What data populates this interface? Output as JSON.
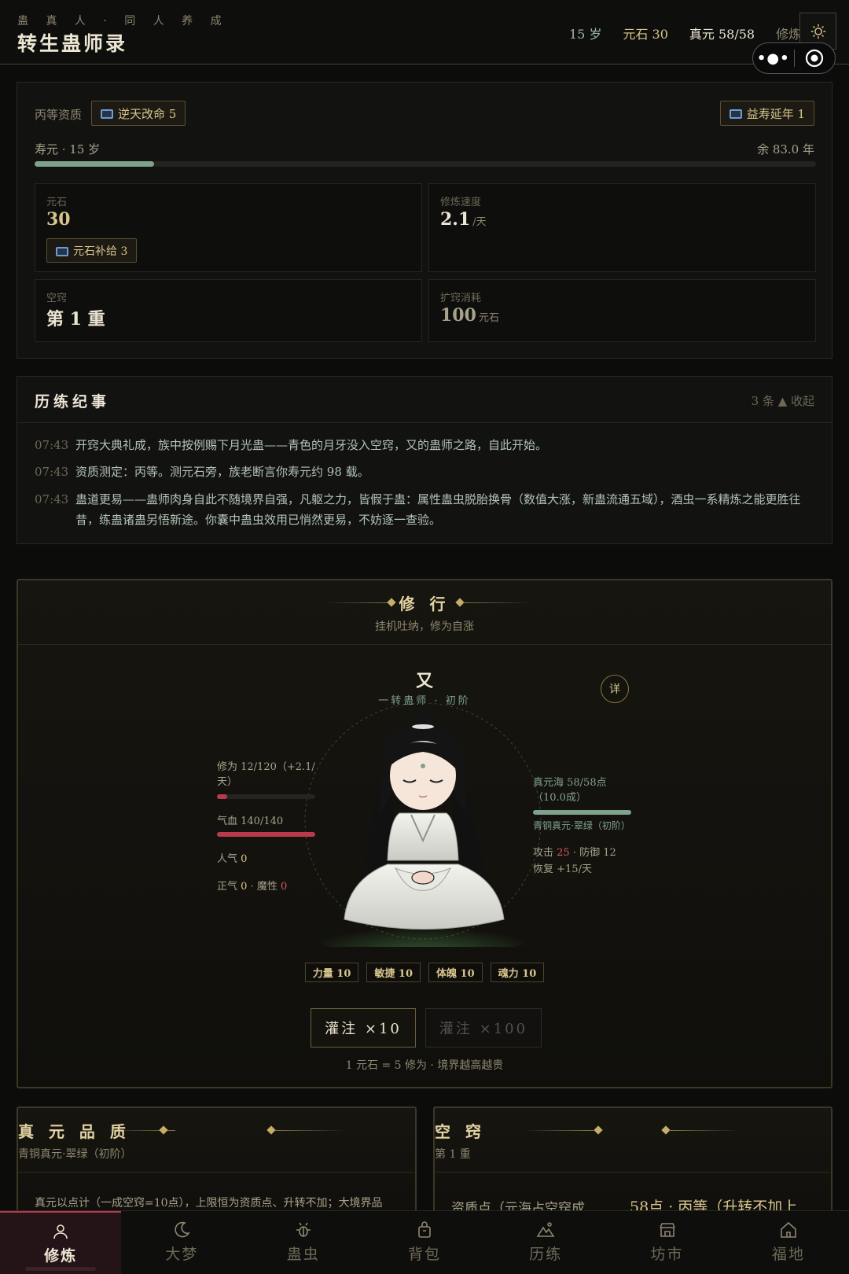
{
  "header": {
    "subtitle": "蛊 真 人 · 同 人 养 成",
    "title": "转生蛊师录",
    "stats": {
      "age": "15 岁",
      "yuanshi": "元石 30",
      "zhenyuan": "真元 58/58",
      "xiulian": "修炼 +"
    },
    "icons": {
      "settings": "sun-icon",
      "more": "more-dots-icon",
      "record": "target-icon"
    }
  },
  "status": {
    "aptitude": "丙等资质",
    "ad_fate": "逆天改命 5",
    "ad_life": "益寿延年 1",
    "lifespan_label": "寿元 · 15 岁",
    "lifespan_remain": "余 83.0 年",
    "lifespan_progress": 0.153,
    "cards": {
      "yuanshi": {
        "label": "元石",
        "value": "30",
        "ad": "元石补给 3"
      },
      "speed": {
        "label": "修炼速度",
        "value": "2.1",
        "unit": "/天"
      },
      "aperture": {
        "label": "空窍",
        "value": "第 1 重"
      },
      "expand": {
        "label": "扩窍消耗",
        "value": "100",
        "unit": "元石"
      }
    }
  },
  "log": {
    "title": "历练纪事",
    "control": "3 条 ▲ 收起",
    "entries": [
      {
        "time": "07:43",
        "text": "开窍大典礼成，族中按例赐下月光蛊——青色的月牙没入空窍，又的蛊师之路，自此开始。"
      },
      {
        "time": "07:43",
        "text": "资质测定：丙等。测元石旁，族老断言你寿元约 98 载。"
      },
      {
        "time": "07:43",
        "text": "蛊道更易——蛊师肉身自此不随境界自强，凡躯之力，皆假于蛊：属性蛊虫脱胎换骨（数值大涨，新蛊流通五域），酒虫一系精炼之能更胜往昔，练蛊诸蛊另悟新途。你囊中蛊虫效用已悄然更易，不妨逐一查验。"
      }
    ]
  },
  "cultivation": {
    "title": "修 行",
    "subtitle": "挂机吐纳，修为自涨",
    "name": "又",
    "rank": "一转蛊师 · 初阶",
    "detail": "详",
    "cult_label": "修为 12/120（+2.1/天）",
    "cult_progress": 0.1,
    "hp_label": "气血 140/140",
    "hp_progress": 1.0,
    "fame_label": "人气",
    "fame_value": "0",
    "justice_label": "正气",
    "justice_value": "0",
    "demon_label": "· 魔性",
    "demon_value": "0",
    "sea_label": "真元海 58/58点（10.0成）",
    "sea_progress": 1.0,
    "sea_quality": "青铜真元·翠绿（初阶）",
    "atk_label": "攻击",
    "atk_value": "25",
    "def_label": "· 防御 12",
    "regen": "恢复 +15/天",
    "attributes": [
      {
        "label": "力量 10"
      },
      {
        "label": "敏捷 10"
      },
      {
        "label": "体魄 10"
      },
      {
        "label": "魂力 10"
      }
    ],
    "infuse10": "灌注 ×10",
    "infuse100": "灌注 ×100",
    "note": "1 元石 = 5 修为 · 境界越高越贵",
    "colors": {
      "hp": "#b83a4b",
      "sea": "#7fa28c",
      "accent": "#d8c58e"
    }
  },
  "quality_panel": {
    "title": "真 元 品 质",
    "subtitle": "青铜真元·翠绿（初阶）",
    "text": "真元以点计（一成空窍=10点），上限恒为资质点、升转不加；大境界品"
  },
  "aperture_panel": {
    "title": "空 窍",
    "subtitle": "第 1 重",
    "row_label": "资质点（元海占空窍成",
    "row_value": "58点 · 丙等（升转不加上"
  },
  "nav": [
    {
      "label": "修炼",
      "icon": "person-icon",
      "active": true
    },
    {
      "label": "大梦",
      "icon": "moon-icon",
      "active": false
    },
    {
      "label": "蛊虫",
      "icon": "bug-icon",
      "active": false
    },
    {
      "label": "背包",
      "icon": "bag-icon",
      "active": false
    },
    {
      "label": "历练",
      "icon": "mountain-icon",
      "active": false
    },
    {
      "label": "坊市",
      "icon": "shop-icon",
      "active": false
    },
    {
      "label": "福地",
      "icon": "home-icon",
      "active": false
    }
  ]
}
